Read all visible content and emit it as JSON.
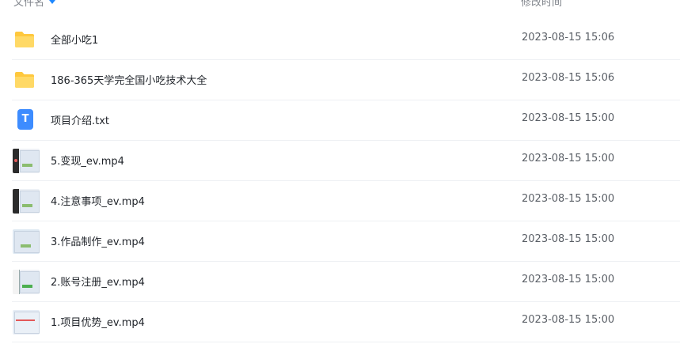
{
  "header": {
    "name_label": "文件名",
    "time_label": "修改时间"
  },
  "files": [
    {
      "name": "全部小吃1",
      "modified": "2023-08-15 15:06",
      "type": "folder",
      "icon": "folder-icon"
    },
    {
      "name": "186-365天学完全国小吃技术大全",
      "modified": "2023-08-15 15:06",
      "type": "folder",
      "icon": "folder-icon"
    },
    {
      "name": "项目介绍.txt",
      "modified": "2023-08-15 15:00",
      "type": "txt",
      "icon": "txt-file-icon",
      "icon_letter": "T"
    },
    {
      "name": "5.变现_ev.mp4",
      "modified": "2023-08-15 15:00",
      "type": "video",
      "icon": "video-thumbnail"
    },
    {
      "name": "4.注意事项_ev.mp4",
      "modified": "2023-08-15 15:00",
      "type": "video",
      "icon": "video-thumbnail"
    },
    {
      "name": "3.作品制作_ev.mp4",
      "modified": "2023-08-15 15:00",
      "type": "video",
      "icon": "video-thumbnail"
    },
    {
      "name": "2.账号注册_ev.mp4",
      "modified": "2023-08-15 15:00",
      "type": "video",
      "icon": "video-thumbnail"
    },
    {
      "name": "1.项目优势_ev.mp4",
      "modified": "2023-08-15 15:00",
      "type": "video",
      "icon": "video-thumbnail"
    }
  ],
  "colors": {
    "accent": "#1e88ff",
    "folder": "#ffc83d",
    "txt_icon": "#3d8cff"
  }
}
